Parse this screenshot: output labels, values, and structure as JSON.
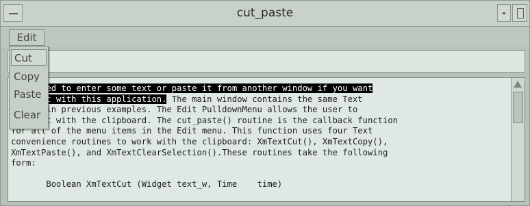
{
  "window": {
    "title": "cut_paste"
  },
  "menubar": {
    "edit_label": "Edit"
  },
  "edit_menu": {
    "items": [
      "Cut",
      "Copy",
      "Paste",
      "Clear"
    ],
    "active_item": "Cut"
  },
  "textarea": {
    "selected_text": " you need to enter some text or paste it from another window if you want\nperiment with this application.",
    "lines": [
      " you need to enter some text or paste it from another window if you want",
      "periment with this application. The main window contains the same Text",
      "s used in previous examples. The Edit PulldownMenu allows the user to",
      "interact with the clipboard. The cut_paste() routine is the callback function",
      "for all of the menu items in the Edit menu. This function uses four Text",
      "convenience routines to work with the clipboard: XmTextCut(), XmTextCopy(),",
      "XmTextPaste(), and XmTextClearSelection().These routines take the following",
      "form:",
      "",
      "       Boolean XmTextCut (Widget text_w, Time    time)"
    ]
  },
  "colors": {
    "background": "#b9c5bc",
    "text_area": "#dfe8e2",
    "selection": "#000000"
  }
}
